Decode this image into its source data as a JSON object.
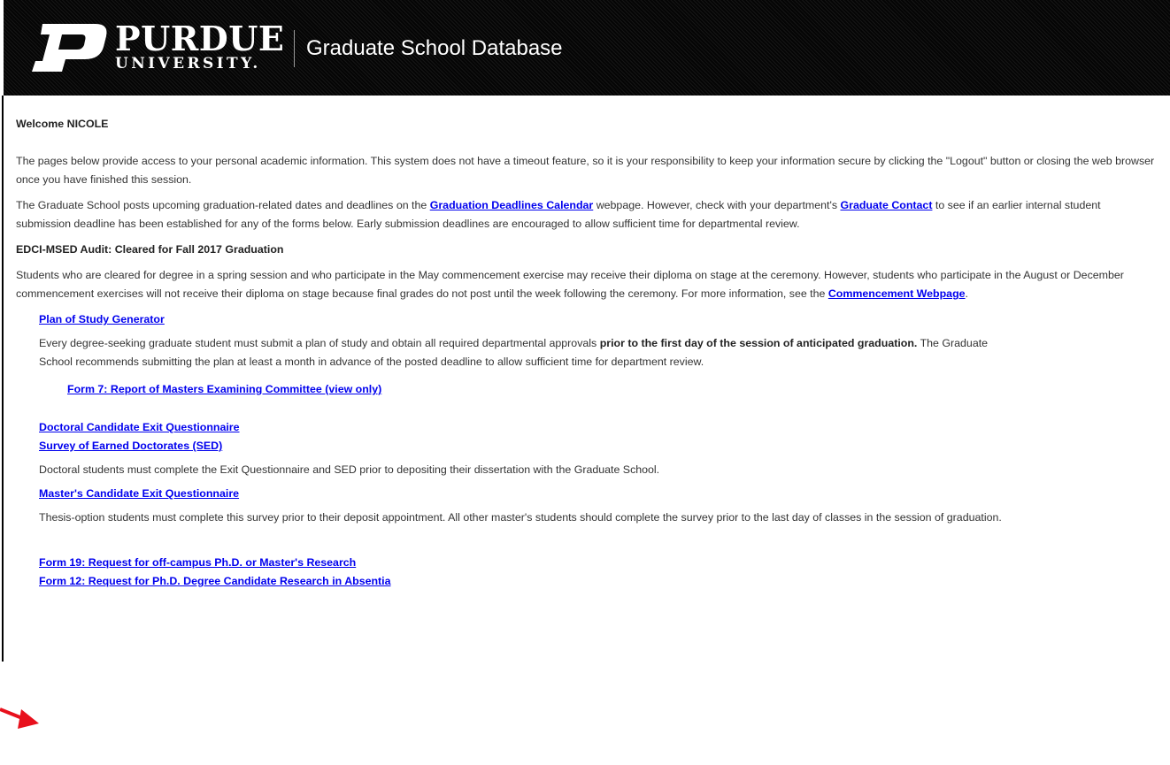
{
  "header": {
    "logo_name": "PURDUE",
    "logo_sub": "UNIVERSITY.",
    "title": "Graduate School Database"
  },
  "welcome": "Welcome NICOLE",
  "intro": "The pages below provide access to your personal academic information. This system does not have a timeout feature, so it is your responsibility to keep your information secure by clicking the \"Logout\" button or closing the web browser once you have finished this session.",
  "deadlines": {
    "part1": "The Graduate School posts upcoming graduation-related dates and deadlines on the ",
    "calendar_link": "Graduation Deadlines Calendar",
    "part2": " webpage. However, check with your department's ",
    "contact_link": "Graduate Contact",
    "part3": " to see if an earlier internal student submission deadline has been established for any of the forms below. Early submission deadlines are encouraged to allow sufficient time for departmental review."
  },
  "audit": "EDCI-MSED Audit: Cleared for Fall 2017 Graduation",
  "commencement": {
    "part1": "Students who are cleared for degree in a spring session and who participate in the May commencement exercise may receive their diploma on stage at the ceremony. However, students who participate in the August or December commencement exercises will not receive their diploma on stage because final grades do not post until the week following the ceremony. For more information, see the ",
    "link": "Commencement Webpage",
    "part2": "."
  },
  "plan_of_study": {
    "link": "Plan of Study Generator",
    "desc1": "Every degree-seeking graduate student must submit a plan of study and obtain all required departmental approvals ",
    "desc_bold": "prior to the first day of the session of anticipated graduation.",
    "desc2": " The Graduate School recommends submitting the plan at least a month in advance of the posted deadline to allow sufficient time for department review.",
    "form7_link": "Form 7: Report of Masters Examining Committee (view only)"
  },
  "doctoral": {
    "exit_link": "Doctoral Candidate Exit Questionnaire",
    "sed_link": "Survey of Earned Doctorates (SED)",
    "desc": "Doctoral students must complete the Exit Questionnaire and SED prior to depositing their dissertation with the Graduate School."
  },
  "masters": {
    "exit_link": "Master's Candidate Exit Questionnaire",
    "desc": "Thesis-option students must complete this survey prior to their deposit appointment. All other master's students should complete the survey prior to the last day of classes in the session of graduation."
  },
  "forms": {
    "form19_link": "Form 19: Request for off-campus Ph.D. or Master's Research",
    "form12_link": "Form 12: Request for Ph.D. Degree Candidate Research in Absentia"
  },
  "icons": {
    "logo": "purdue-p-logo-icon",
    "arrow": "red-arrow-icon"
  },
  "colors": {
    "link": "#0000ee",
    "header_bg": "#0a0a0a",
    "arrow": "#e8101c"
  }
}
